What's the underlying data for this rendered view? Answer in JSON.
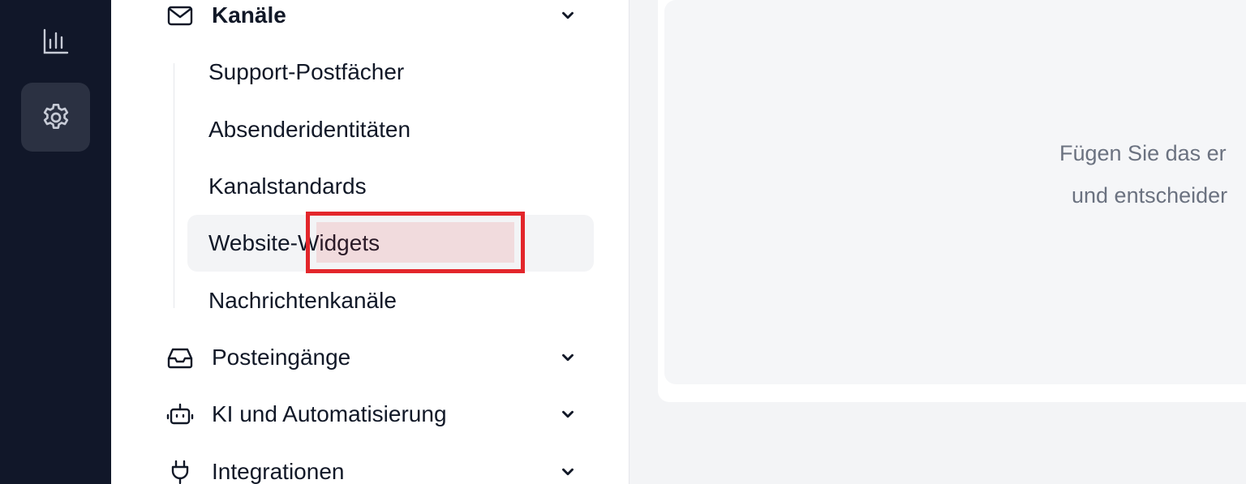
{
  "rail": {
    "items": [
      {
        "icon": "chart-bar-icon",
        "active": false
      },
      {
        "icon": "gear-icon",
        "active": true
      }
    ]
  },
  "nav": {
    "channels": {
      "label": "Kanäle",
      "icon": "mail-icon",
      "items": [
        {
          "label": "Support-Postfächer",
          "active": false
        },
        {
          "label": "Absenderidentitäten",
          "active": false
        },
        {
          "label": "Kanalstandards",
          "active": false
        },
        {
          "label": "Website-Widgets",
          "active": true
        },
        {
          "label": "Nachrichtenkanäle",
          "active": false
        }
      ]
    },
    "inboxes": {
      "label": "Posteingänge",
      "icon": "inbox-icon"
    },
    "ai": {
      "label": "KI und Automatisierung",
      "icon": "robot-icon"
    },
    "integrations": {
      "label": "Integrationen",
      "icon": "plug-icon"
    }
  },
  "main": {
    "empty_state": {
      "line1": "Fügen Sie das er",
      "line2": "und entscheider"
    }
  },
  "colors": {
    "rail_bg": "#111729",
    "highlight": "#e3262b"
  }
}
